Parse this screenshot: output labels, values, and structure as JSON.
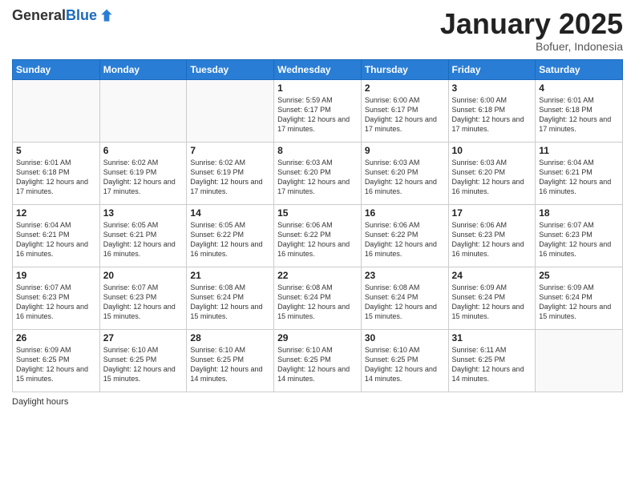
{
  "header": {
    "logo_general": "General",
    "logo_blue": "Blue",
    "month": "January 2025",
    "location": "Bofuer, Indonesia"
  },
  "footer": {
    "label": "Daylight hours"
  },
  "days_of_week": [
    "Sunday",
    "Monday",
    "Tuesday",
    "Wednesday",
    "Thursday",
    "Friday",
    "Saturday"
  ],
  "weeks": [
    [
      {
        "day": "",
        "sunrise": "",
        "sunset": "",
        "daylight": "",
        "empty": true
      },
      {
        "day": "",
        "sunrise": "",
        "sunset": "",
        "daylight": "",
        "empty": true
      },
      {
        "day": "",
        "sunrise": "",
        "sunset": "",
        "daylight": "",
        "empty": true
      },
      {
        "day": "1",
        "sunrise": "Sunrise: 5:59 AM",
        "sunset": "Sunset: 6:17 PM",
        "daylight": "Daylight: 12 hours and 17 minutes."
      },
      {
        "day": "2",
        "sunrise": "Sunrise: 6:00 AM",
        "sunset": "Sunset: 6:17 PM",
        "daylight": "Daylight: 12 hours and 17 minutes."
      },
      {
        "day": "3",
        "sunrise": "Sunrise: 6:00 AM",
        "sunset": "Sunset: 6:18 PM",
        "daylight": "Daylight: 12 hours and 17 minutes."
      },
      {
        "day": "4",
        "sunrise": "Sunrise: 6:01 AM",
        "sunset": "Sunset: 6:18 PM",
        "daylight": "Daylight: 12 hours and 17 minutes."
      }
    ],
    [
      {
        "day": "5",
        "sunrise": "Sunrise: 6:01 AM",
        "sunset": "Sunset: 6:18 PM",
        "daylight": "Daylight: 12 hours and 17 minutes."
      },
      {
        "day": "6",
        "sunrise": "Sunrise: 6:02 AM",
        "sunset": "Sunset: 6:19 PM",
        "daylight": "Daylight: 12 hours and 17 minutes."
      },
      {
        "day": "7",
        "sunrise": "Sunrise: 6:02 AM",
        "sunset": "Sunset: 6:19 PM",
        "daylight": "Daylight: 12 hours and 17 minutes."
      },
      {
        "day": "8",
        "sunrise": "Sunrise: 6:03 AM",
        "sunset": "Sunset: 6:20 PM",
        "daylight": "Daylight: 12 hours and 17 minutes."
      },
      {
        "day": "9",
        "sunrise": "Sunrise: 6:03 AM",
        "sunset": "Sunset: 6:20 PM",
        "daylight": "Daylight: 12 hours and 16 minutes."
      },
      {
        "day": "10",
        "sunrise": "Sunrise: 6:03 AM",
        "sunset": "Sunset: 6:20 PM",
        "daylight": "Daylight: 12 hours and 16 minutes."
      },
      {
        "day": "11",
        "sunrise": "Sunrise: 6:04 AM",
        "sunset": "Sunset: 6:21 PM",
        "daylight": "Daylight: 12 hours and 16 minutes."
      }
    ],
    [
      {
        "day": "12",
        "sunrise": "Sunrise: 6:04 AM",
        "sunset": "Sunset: 6:21 PM",
        "daylight": "Daylight: 12 hours and 16 minutes."
      },
      {
        "day": "13",
        "sunrise": "Sunrise: 6:05 AM",
        "sunset": "Sunset: 6:21 PM",
        "daylight": "Daylight: 12 hours and 16 minutes."
      },
      {
        "day": "14",
        "sunrise": "Sunrise: 6:05 AM",
        "sunset": "Sunset: 6:22 PM",
        "daylight": "Daylight: 12 hours and 16 minutes."
      },
      {
        "day": "15",
        "sunrise": "Sunrise: 6:06 AM",
        "sunset": "Sunset: 6:22 PM",
        "daylight": "Daylight: 12 hours and 16 minutes."
      },
      {
        "day": "16",
        "sunrise": "Sunrise: 6:06 AM",
        "sunset": "Sunset: 6:22 PM",
        "daylight": "Daylight: 12 hours and 16 minutes."
      },
      {
        "day": "17",
        "sunrise": "Sunrise: 6:06 AM",
        "sunset": "Sunset: 6:23 PM",
        "daylight": "Daylight: 12 hours and 16 minutes."
      },
      {
        "day": "18",
        "sunrise": "Sunrise: 6:07 AM",
        "sunset": "Sunset: 6:23 PM",
        "daylight": "Daylight: 12 hours and 16 minutes."
      }
    ],
    [
      {
        "day": "19",
        "sunrise": "Sunrise: 6:07 AM",
        "sunset": "Sunset: 6:23 PM",
        "daylight": "Daylight: 12 hours and 16 minutes."
      },
      {
        "day": "20",
        "sunrise": "Sunrise: 6:07 AM",
        "sunset": "Sunset: 6:23 PM",
        "daylight": "Daylight: 12 hours and 15 minutes."
      },
      {
        "day": "21",
        "sunrise": "Sunrise: 6:08 AM",
        "sunset": "Sunset: 6:24 PM",
        "daylight": "Daylight: 12 hours and 15 minutes."
      },
      {
        "day": "22",
        "sunrise": "Sunrise: 6:08 AM",
        "sunset": "Sunset: 6:24 PM",
        "daylight": "Daylight: 12 hours and 15 minutes."
      },
      {
        "day": "23",
        "sunrise": "Sunrise: 6:08 AM",
        "sunset": "Sunset: 6:24 PM",
        "daylight": "Daylight: 12 hours and 15 minutes."
      },
      {
        "day": "24",
        "sunrise": "Sunrise: 6:09 AM",
        "sunset": "Sunset: 6:24 PM",
        "daylight": "Daylight: 12 hours and 15 minutes."
      },
      {
        "day": "25",
        "sunrise": "Sunrise: 6:09 AM",
        "sunset": "Sunset: 6:24 PM",
        "daylight": "Daylight: 12 hours and 15 minutes."
      }
    ],
    [
      {
        "day": "26",
        "sunrise": "Sunrise: 6:09 AM",
        "sunset": "Sunset: 6:25 PM",
        "daylight": "Daylight: 12 hours and 15 minutes."
      },
      {
        "day": "27",
        "sunrise": "Sunrise: 6:10 AM",
        "sunset": "Sunset: 6:25 PM",
        "daylight": "Daylight: 12 hours and 15 minutes."
      },
      {
        "day": "28",
        "sunrise": "Sunrise: 6:10 AM",
        "sunset": "Sunset: 6:25 PM",
        "daylight": "Daylight: 12 hours and 14 minutes."
      },
      {
        "day": "29",
        "sunrise": "Sunrise: 6:10 AM",
        "sunset": "Sunset: 6:25 PM",
        "daylight": "Daylight: 12 hours and 14 minutes."
      },
      {
        "day": "30",
        "sunrise": "Sunrise: 6:10 AM",
        "sunset": "Sunset: 6:25 PM",
        "daylight": "Daylight: 12 hours and 14 minutes."
      },
      {
        "day": "31",
        "sunrise": "Sunrise: 6:11 AM",
        "sunset": "Sunset: 6:25 PM",
        "daylight": "Daylight: 12 hours and 14 minutes."
      },
      {
        "day": "",
        "sunrise": "",
        "sunset": "",
        "daylight": "",
        "empty": true
      }
    ]
  ]
}
